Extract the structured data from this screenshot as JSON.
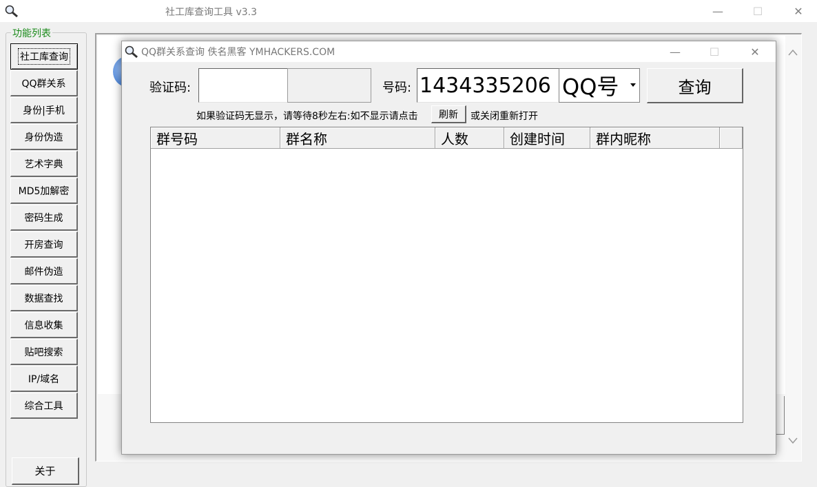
{
  "main_window": {
    "title": "社工库查询工具 v3.3",
    "controls": {
      "minimize": "—",
      "maximize": "☐",
      "close": "✕"
    }
  },
  "sidebar": {
    "group_label": "功能列表",
    "items": [
      {
        "label": "社工库查询"
      },
      {
        "label": "QQ群关系"
      },
      {
        "label": "身份|手机"
      },
      {
        "label": "身份伪造"
      },
      {
        "label": "艺术字典"
      },
      {
        "label": "MD5加解密"
      },
      {
        "label": "密码生成"
      },
      {
        "label": "开房查询"
      },
      {
        "label": "邮件伪造"
      },
      {
        "label": "数据查找"
      },
      {
        "label": "信息收集"
      },
      {
        "label": "贴吧搜索"
      },
      {
        "label": "IP/域名"
      },
      {
        "label": "综合工具"
      }
    ],
    "about_label": "关于"
  },
  "dialog": {
    "title": "QQ群关系查询  佚名黑客 YMHACKERS.COM",
    "controls": {
      "minimize": "—",
      "maximize": "☐",
      "close": "✕"
    },
    "captcha_label": "验证码:",
    "captcha_value": "",
    "number_label": "号码:",
    "number_value": "1434335206",
    "type_selected": "QQ号",
    "query_button": "查询",
    "hint_before": "如果验证码无显示，请等待8秒左右:如不显示请点击",
    "refresh_button": "刷新",
    "hint_after": "或关闭重新打开",
    "table": {
      "columns": [
        "群号码",
        "群名称",
        "人数",
        "创建时间",
        "群内昵称"
      ],
      "rows": []
    }
  },
  "colors": {
    "group_label": "#1a8a1a",
    "content_accent": "#2c6fd0"
  }
}
